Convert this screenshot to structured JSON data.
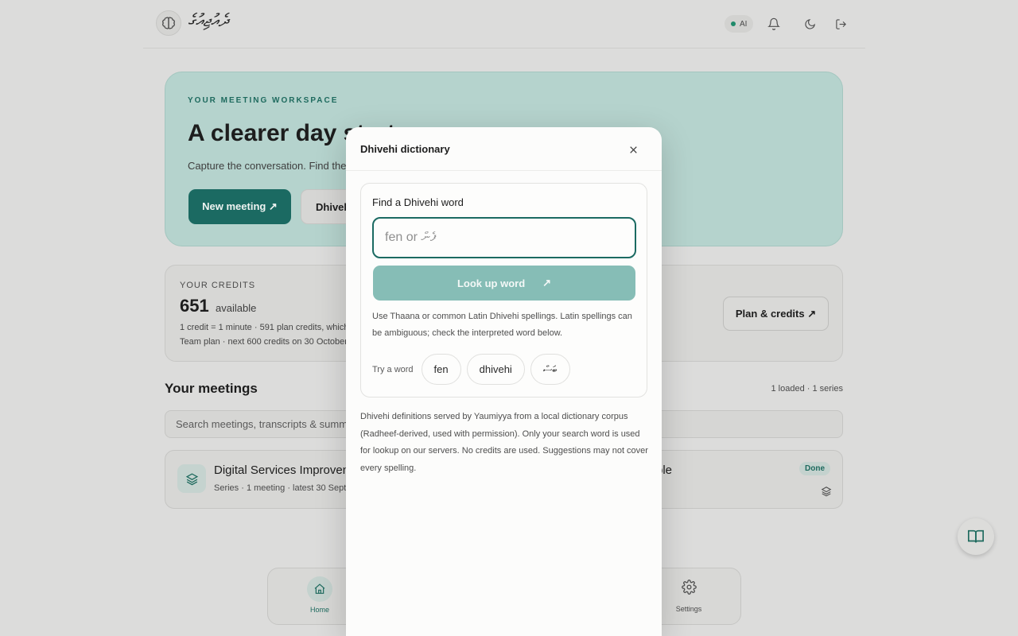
{
  "header": {
    "logo_text": "ދެއުޖިއުގެ",
    "ai_label": "AI"
  },
  "hero": {
    "eyebrow": "YOUR MEETING WORKSPACE",
    "title": "A clearer day starts",
    "subtitle": "Capture the conversation. Find the",
    "primary_button": "New meeting ↗",
    "secondary_button": "Dhivehi"
  },
  "credits": {
    "label": "YOUR CREDITS",
    "amount": "651",
    "available_label": "available",
    "line1": "1 credit = 1 minute · 591 plan credits, which e",
    "line2": "Team plan · next 600 credits on 30 October",
    "plan_button": "Plan & credits ↗"
  },
  "meetings": {
    "title": "Your meetings",
    "count": "1 loaded · 1 series",
    "search_placeholder": "Search meetings, transcripts & summa",
    "card": {
      "name": "Digital Services Improven",
      "name_right": "ble",
      "meta": "Series · 1 meeting · latest 30 Sept",
      "status": "Done"
    }
  },
  "bottom_nav": {
    "home_label": "Home",
    "settings_label": "Settings"
  },
  "modal": {
    "title": "Dhivehi dictionary",
    "finder_label": "Find a Dhivehi word",
    "input_placeholder": "fen or ފެން",
    "lookup_button": "Look up word",
    "lookup_arrow": "↗",
    "help_text": "Use Thaana or common Latin Dhivehi spellings. Latin spellings can be ambiguous; check the interpreted word below.",
    "try_label": "Try a word",
    "chips": [
      "fen",
      "dhivehi",
      "ބަސް"
    ],
    "footer_text": "Dhivehi definitions served by Yaumiyya from a local dictionary corpus (Radheef-derived, used with permission). Only your search word is used for lookup on our servers. No credits are used. Suggestions may not cover every spelling."
  },
  "colors": {
    "accent": "#1b6a62",
    "accent_soft": "#86bdb6",
    "hero_bg": "#b5d3cd",
    "modal_bg": "#fcfcfb"
  }
}
